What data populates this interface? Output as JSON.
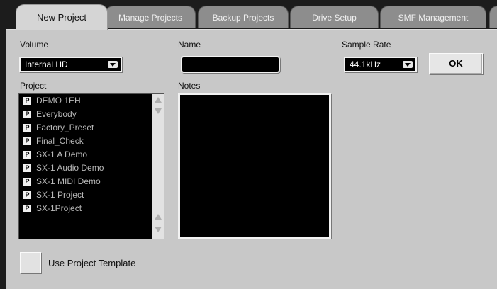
{
  "tabs": [
    {
      "label": "New Project",
      "active": true
    },
    {
      "label": "Manage Projects",
      "active": false
    },
    {
      "label": "Backup Projects",
      "active": false
    },
    {
      "label": "Drive Setup",
      "active": false
    },
    {
      "label": "SMF Management",
      "active": false
    }
  ],
  "volume": {
    "label": "Volume",
    "value": "Internal HD"
  },
  "name": {
    "label": "Name",
    "value": ""
  },
  "sample_rate": {
    "label": "Sample Rate",
    "value": "44.1kHz"
  },
  "ok_label": "OK",
  "project": {
    "label": "Project",
    "icon_letter": "P",
    "items": [
      "DEMO 1EH",
      "Everybody",
      "Factory_Preset",
      "Final_Check",
      "SX-1 A Demo",
      "SX-1 Audio Demo",
      "SX-1 MIDI Demo",
      "SX-1 Project",
      "SX-1Project"
    ]
  },
  "notes": {
    "label": "Notes",
    "value": ""
  },
  "template": {
    "label": "Use Project Template",
    "checked": false
  },
  "colors": {
    "background": "#c8c8c8",
    "tab_active": "#d5d5d5",
    "tab_inactive": "#8d8d8d",
    "field_bg": "#000000",
    "list_text": "#b9b9b9"
  },
  "icons": [
    "dropdown-arrow-icon",
    "scroll-up-icon",
    "scroll-down-icon",
    "project-file-icon"
  ]
}
